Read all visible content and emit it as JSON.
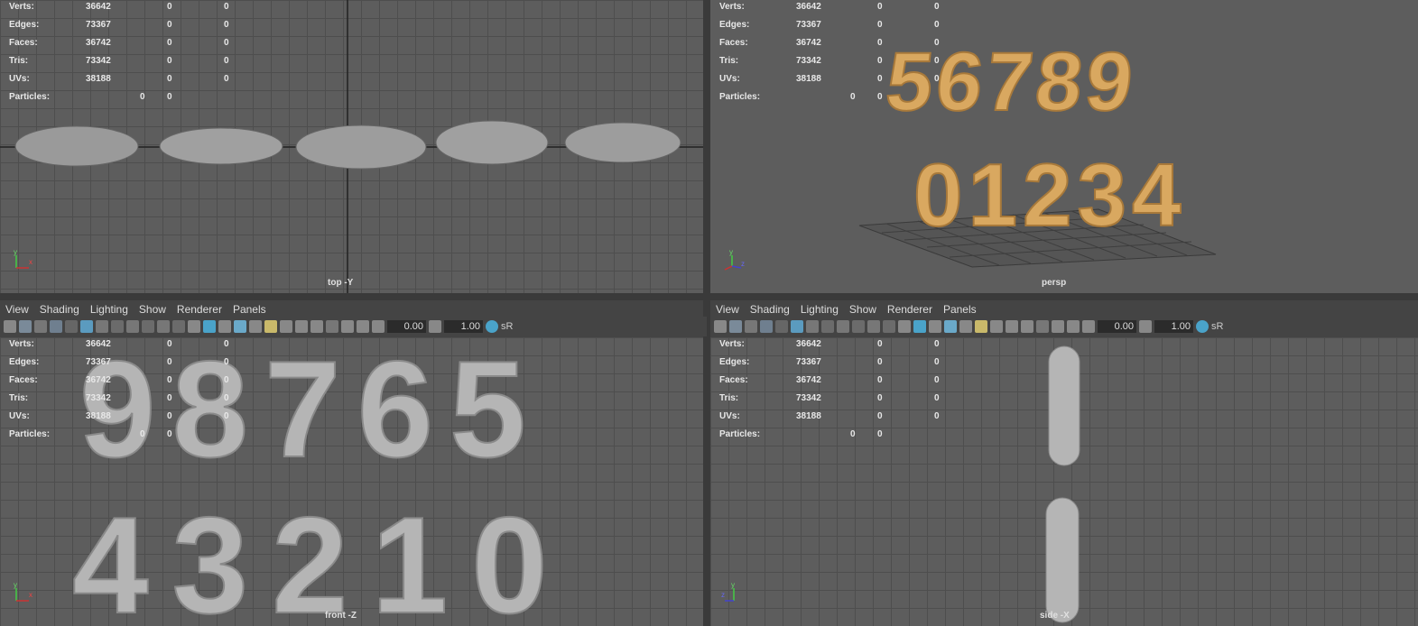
{
  "stats": {
    "verts_label": "Verts:",
    "verts": [
      "36642",
      "0",
      "0"
    ],
    "edges_label": "Edges:",
    "edges": [
      "73367",
      "0",
      "0"
    ],
    "faces_label": "Faces:",
    "faces": [
      "36742",
      "0",
      "0"
    ],
    "tris_label": "Tris:",
    "tris": [
      "73342",
      "0",
      "0"
    ],
    "uvs_label": "UVs:",
    "uvs": [
      "38188",
      "0",
      "0"
    ],
    "particles_label": "Particles:",
    "particles": [
      "0",
      "0"
    ]
  },
  "viewports": {
    "top_label": "top -Y",
    "persp_label": "persp",
    "front_label": "front -Z",
    "side_label": "side -X"
  },
  "menus": [
    "View",
    "Shading",
    "Lighting",
    "Show",
    "Renderer",
    "Panels"
  ],
  "toolbar": {
    "exposure": "0.00",
    "gamma": "1.00",
    "colorspace": "sR"
  },
  "scene": {
    "top_row_digits": "56789",
    "bottom_row_digits": "01234",
    "front_top_mirrored": "98765",
    "front_bottom_mirrored": "43210",
    "side_top_glyph": "I",
    "side_bottom_glyph": "I"
  },
  "colors": {
    "model_gold": "#d9a860",
    "model_grey": "#b5b5b5",
    "viewport_bg": "#5d5d5d",
    "grid": "#4e4e4e"
  }
}
